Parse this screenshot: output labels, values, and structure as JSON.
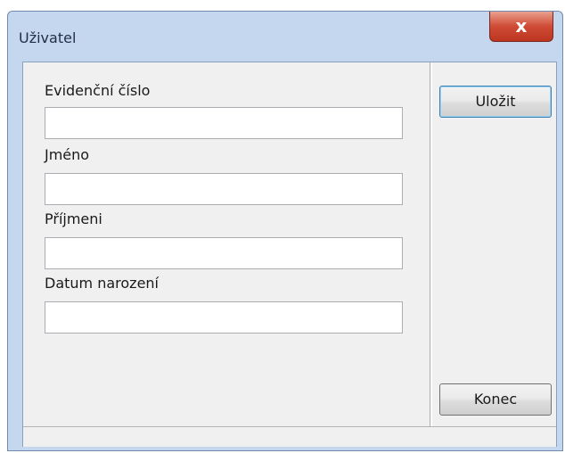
{
  "window": {
    "title": "Uživatel",
    "close_glyph": "x"
  },
  "form": {
    "fields": [
      {
        "label": "Evidenční číslo",
        "value": ""
      },
      {
        "label": "Jméno",
        "value": ""
      },
      {
        "label": "Příjmeni",
        "value": ""
      },
      {
        "label": "Datum narození",
        "value": ""
      }
    ]
  },
  "buttons": {
    "save_label": "Uložit",
    "close_label": "Konec"
  }
}
